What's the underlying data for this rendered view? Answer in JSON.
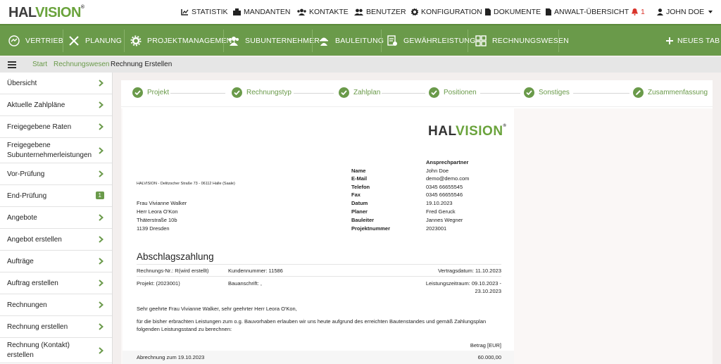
{
  "app": {
    "logo_hal": "HAL",
    "logo_vision": "VISION",
    "logo_reg": "®"
  },
  "topnav": [
    {
      "icon": "chart-icon",
      "label": "STATISTIK"
    },
    {
      "icon": "building-icon",
      "label": "MANDANTEN"
    },
    {
      "icon": "contacts-icon",
      "label": "KONTAKTE"
    },
    {
      "icon": "users-icon",
      "label": "BENUTZER"
    },
    {
      "icon": "gear-icon",
      "label": "KONFIGURATION"
    },
    {
      "icon": "document-icon",
      "label": "DOKUMENTE"
    },
    {
      "icon": "document-icon",
      "label": "ANWALT-ÜBERSICHT"
    },
    {
      "icon": "bell-icon",
      "label": "1"
    },
    {
      "icon": "user-icon",
      "label": "JOHN DOE"
    }
  ],
  "greennav": [
    {
      "icon": "sales-icon",
      "label": "VERTRIEB"
    },
    {
      "icon": "tools-icon",
      "label": "PLANUNG"
    },
    {
      "icon": "cog-icon",
      "label": "PROJEKTMANAGEMENT"
    },
    {
      "icon": "subcontractor-icon",
      "label": "SUBUNTERNEHMER"
    },
    {
      "icon": "worker-icon",
      "label": "BAULEITUNG"
    },
    {
      "icon": "warranty-icon",
      "label": "GEWÄHRLEISTUNG"
    },
    {
      "icon": "accounting-icon",
      "label": "RECHNUNGSWESEN"
    },
    {
      "icon": "plus-icon",
      "label": "NEUES TAB"
    }
  ],
  "breadcrumb": {
    "start": "Start",
    "section": "Rechnungswesen",
    "current": "Rechnung Erstellen"
  },
  "sidebar": [
    {
      "label": "Übersicht"
    },
    {
      "label": "Aktuelle Zahlpläne"
    },
    {
      "label": "Freigegebene Raten"
    },
    {
      "label": "Freigegebene Subunternehmerleistungen",
      "label1": "Freigegebene",
      "label2": "Subunternehmerleistungen"
    },
    {
      "label": "Vor-Prüfung"
    },
    {
      "label": "End-Prüfung",
      "badge": "1"
    },
    {
      "label": "Angebote"
    },
    {
      "label": "Angebot erstellen"
    },
    {
      "label": "Aufträge"
    },
    {
      "label": "Auftrag erstellen"
    },
    {
      "label": "Rechnungen"
    },
    {
      "label": "Rechnung erstellen"
    },
    {
      "label": "Rechnung (Kontakt) erstellen",
      "label1": "Rechnung (Kontakt)",
      "label2": "erstellen"
    }
  ],
  "steps": [
    {
      "label": "Projekt",
      "icon": "check-icon"
    },
    {
      "label": "Rechnungstyp",
      "icon": "check-icon"
    },
    {
      "label": "Zahlplan",
      "icon": "check-icon"
    },
    {
      "label": "Positionen",
      "icon": "check-icon"
    },
    {
      "label": "Sonstiges",
      "icon": "check-icon"
    },
    {
      "label": "Zusammenfassung",
      "icon": "pencil-icon"
    }
  ],
  "document": {
    "logo_hal": "HAL",
    "logo_vision": "VISION",
    "logo_reg": "®",
    "sender_line": "HALVISION - Delitzscher Straße 73 - 06112 Halle (Saale)",
    "recipient": [
      "Frau Vivianne Walker",
      "Herr Leora O'Kon",
      "Thäterstraße 10b",
      "1139 Dresden"
    ],
    "contact_title": "Ansprechpartner",
    "contact": [
      {
        "k": "Name",
        "v": "John Doe"
      },
      {
        "k": "E-Mail",
        "v": "demo@demo.com"
      },
      {
        "k": "Telefon",
        "v": "0345 66655545"
      },
      {
        "k": "Fax",
        "v": "0345 66655546"
      },
      {
        "k": "Datum",
        "v": "19.10.2023"
      },
      {
        "k": "Planer",
        "v": "Fred Geruck"
      },
      {
        "k": "Bauleiter",
        "v": "Jannes Wegner"
      },
      {
        "k": "Projektnummer",
        "v": "2023001"
      }
    ],
    "title": "Abschlagszahlung",
    "invoice_no": "Rechnungs-Nr.: R(wird erstellt)",
    "customer_no": "Kundennummer: 11586",
    "contract_date": "Vertragsdatum: 11.10.2023",
    "project": "Projekt: (2023001)",
    "build_address": "Bauanschrift: ,",
    "period_line1": "Leistungszeitraum: 09.10.2023 -",
    "period_line2": "23.10.2023",
    "salutation": "Sehr geehrte Frau Vivianne Walker, sehr geehrter Herr Leora O'Kon,",
    "body_line1": "für die bisher erbrachten Leistungen zum o.g. Bauvorhaben erlauben wir uns heute aufgrund des erreichten Bautenstandes und gemäß Zahlungsplan",
    "body_line2": "folgenden Leistungsstand zu berechnen:",
    "amount_header": "Betrag [EUR]",
    "row_label": "Abrechnung zum 19.10.2023",
    "row_amount": "60.000,00"
  },
  "colors": {
    "green": "#6a9a4a",
    "logo_green": "#6aa33c",
    "bell_red": "#d9342b"
  }
}
